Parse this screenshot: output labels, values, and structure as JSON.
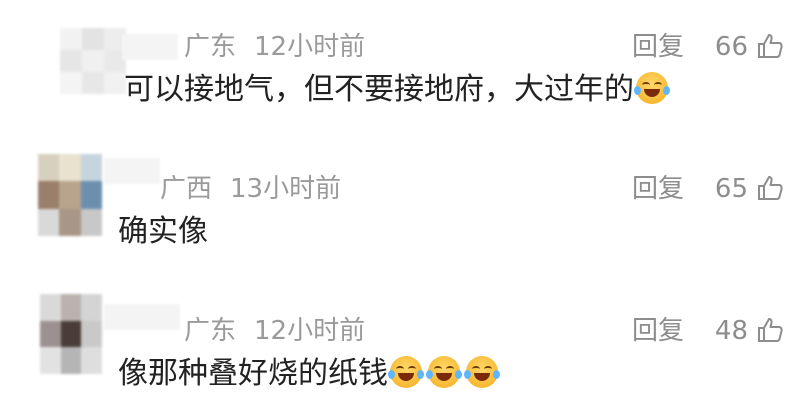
{
  "comments": [
    {
      "location": "广东",
      "time": "12小时前",
      "text": "可以接地气，但不要接地府，大过年的",
      "emoji_count": 1,
      "reply_label": "回复",
      "likes": "66"
    },
    {
      "location": "广西",
      "time": "13小时前",
      "text": "确实像",
      "emoji_count": 0,
      "reply_label": "回复",
      "likes": "65"
    },
    {
      "location": "广东",
      "time": "12小时前",
      "text": "像那种叠好烧的纸钱",
      "emoji_count": 3,
      "reply_label": "回复",
      "likes": "48"
    }
  ],
  "icons": {
    "like": "thumbs-up-icon",
    "emoji": "tears-of-joy-emoji-icon"
  },
  "colors": {
    "text": "#222222",
    "meta": "#9a9a9a",
    "action": "#8d8d8d",
    "background": "#ffffff"
  }
}
